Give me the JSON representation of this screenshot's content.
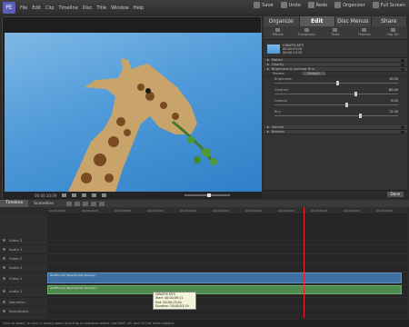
{
  "menubar": {
    "logo": "PE",
    "items": [
      "File",
      "Edit",
      "Clip",
      "Timeline",
      "Disc",
      "Title",
      "Window",
      "Help"
    ],
    "buttons": [
      "Save",
      "Undo",
      "Redo",
      "Organizer",
      "Full Screen"
    ]
  },
  "preview": {
    "time_left": "00:00:10:09"
  },
  "rpanel": {
    "tabs": [
      "Organize",
      "Edit",
      "Disc Menus",
      "Share"
    ],
    "subtabs": [
      "Effects",
      "Transitions",
      "Titles",
      "Themes",
      "Clip Art"
    ],
    "clip_name": "GIRAFFE.MTS",
    "clip_meta": [
      "00:00:03:10",
      "00:00:13:10"
    ],
    "props": [
      "Motion",
      "Opacity",
      "Brightness & Contrast Fine"
    ],
    "preset_label": "Presets",
    "preset_value": "Default",
    "sliders": [
      {
        "label": "Brightness",
        "value": "10.00"
      },
      {
        "label": "Contrast",
        "value": "80.00"
      },
      {
        "label": "Gamma",
        "value": "9.00"
      },
      {
        "label": "Blur",
        "value": "72.00"
      }
    ],
    "props_bottom": [
      "Volume",
      "Balance"
    ],
    "done": "Done"
  },
  "timeline": {
    "tabs": [
      "Timeline",
      "Sceneline"
    ],
    "ruler_ticks": [
      "00;00;00;00",
      "00;00;04;00",
      "00;00;08;00",
      "00;00;12;00",
      "00;00;16;00",
      "00;00;20;00",
      "00;00;24;00",
      "00;00;28;00",
      "00;00;32;00",
      "00;00;36;00",
      "00;00;40;00"
    ],
    "track_labels": [
      "Video 3",
      "Audio 3",
      "Video 2",
      "Audio 2",
      "Video 1",
      "Audio 1",
      "Narration",
      "Soundtrack"
    ],
    "clip_label": "Giraffe Clip [Opacity:Clip Opacity]",
    "tooltip": [
      "GIRAFFE.MTS",
      "Start: 00;00;09;11",
      "End: 00;00;13;00",
      "Duration: 00;00;03;19"
    ]
  },
  "status": "Click to select, or click in empty space and drag to marquee select. Use Shift, Alt, and Ctrl for other options."
}
